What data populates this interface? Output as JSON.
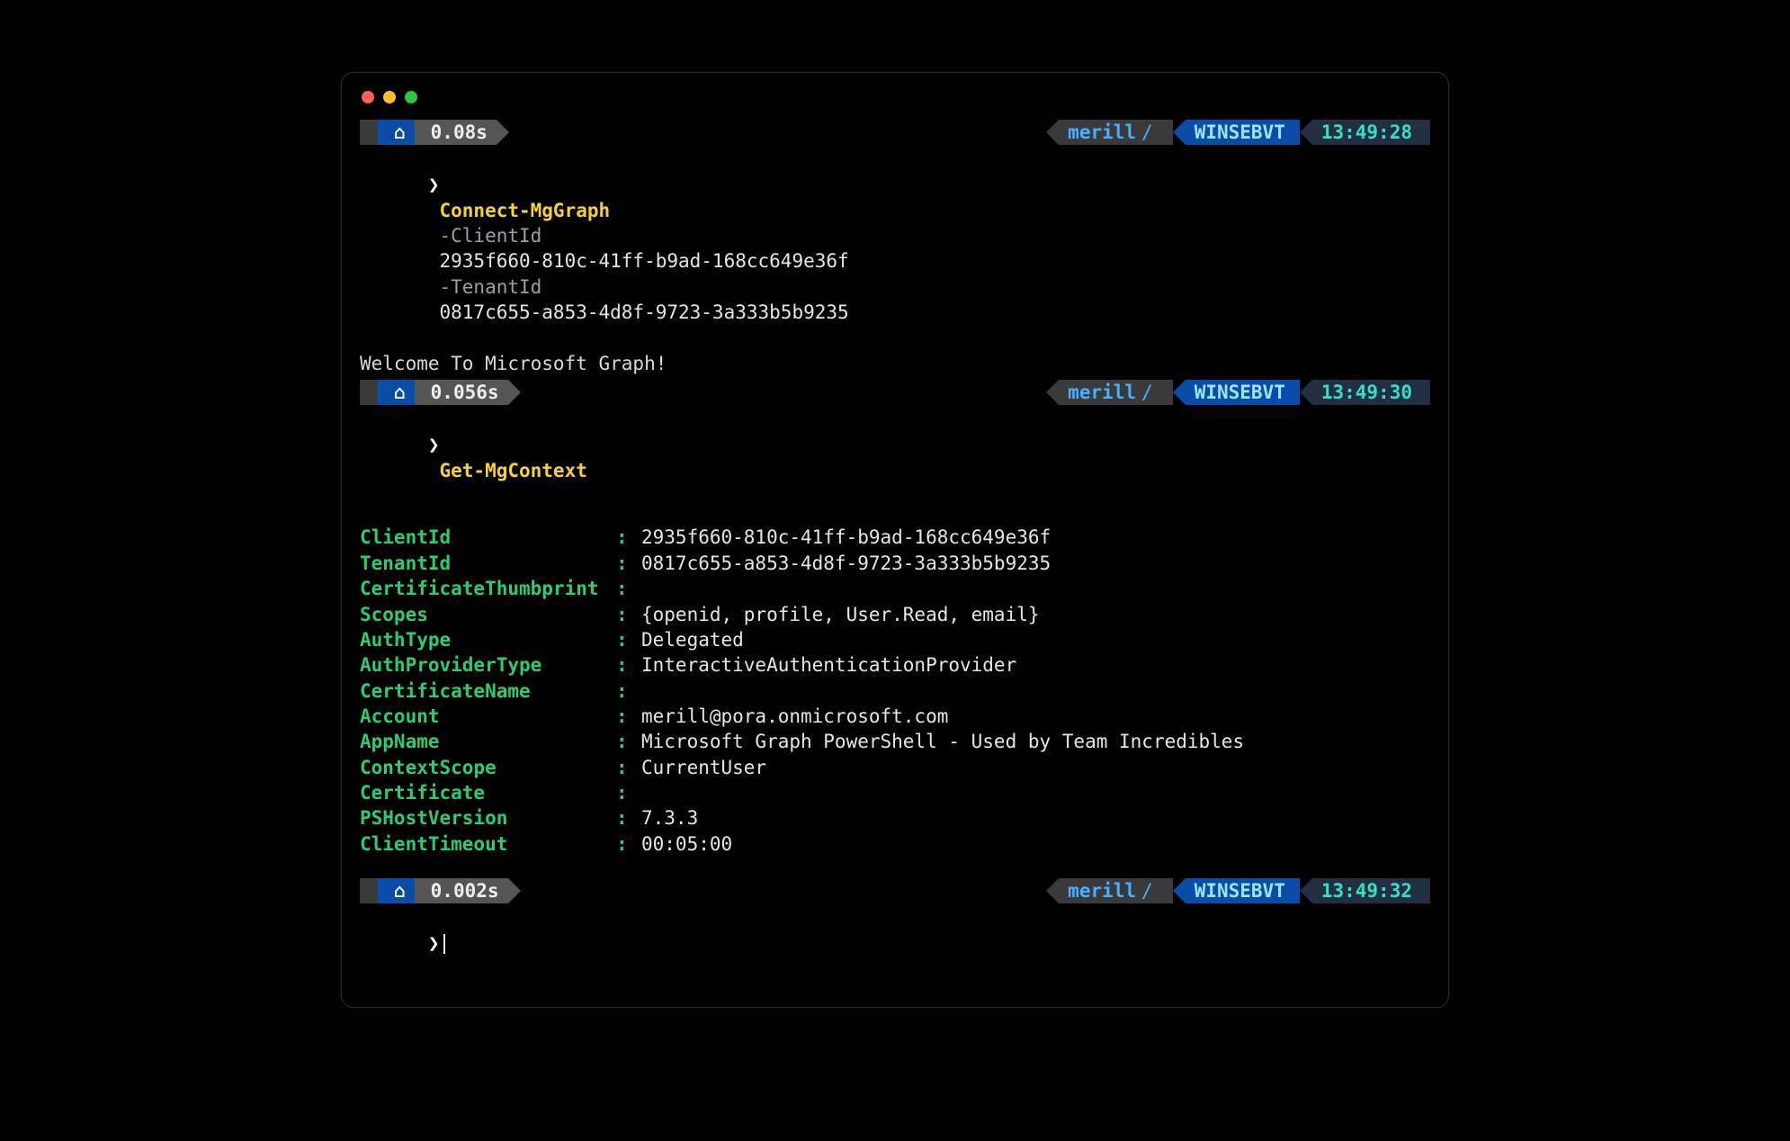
{
  "prompts": [
    {
      "duration": "0.08s",
      "user": "merill",
      "host": "WINSEBVT",
      "clock": "13:49:28",
      "command": "Connect-MgGraph",
      "flag1": "-ClientId",
      "arg1": "2935f660-810c-41ff-b9ad-168cc649e36f",
      "flag2": "-TenantId",
      "arg2": "0817c655-a853-4d8f-9723-3a333b5b9235",
      "output": "Welcome To Microsoft Graph!"
    },
    {
      "duration": "0.056s",
      "user": "merill",
      "host": "WINSEBVT",
      "clock": "13:49:30",
      "command": "Get-MgContext"
    },
    {
      "duration": "0.002s",
      "user": "merill",
      "host": "WINSEBVT",
      "clock": "13:49:32"
    }
  ],
  "context": [
    {
      "k": "ClientId",
      "v": "2935f660-810c-41ff-b9ad-168cc649e36f"
    },
    {
      "k": "TenantId",
      "v": "0817c655-a853-4d8f-9723-3a333b5b9235"
    },
    {
      "k": "CertificateThumbprint",
      "v": ""
    },
    {
      "k": "Scopes",
      "v": "{openid, profile, User.Read, email}"
    },
    {
      "k": "AuthType",
      "v": "Delegated"
    },
    {
      "k": "AuthProviderType",
      "v": "InteractiveAuthenticationProvider"
    },
    {
      "k": "CertificateName",
      "v": ""
    },
    {
      "k": "Account",
      "v": "merill@pora.onmicrosoft.com"
    },
    {
      "k": "AppName",
      "v": "Microsoft Graph PowerShell - Used by Team Incredibles"
    },
    {
      "k": "ContextScope",
      "v": "CurrentUser"
    },
    {
      "k": "Certificate",
      "v": ""
    },
    {
      "k": "PSHostVersion",
      "v": "7.3.3"
    },
    {
      "k": "ClientTimeout",
      "v": "00:05:00"
    }
  ],
  "glyphs": {
    "apple": "",
    "home": "⌂",
    "chevron": "❯",
    "sep": "/"
  }
}
